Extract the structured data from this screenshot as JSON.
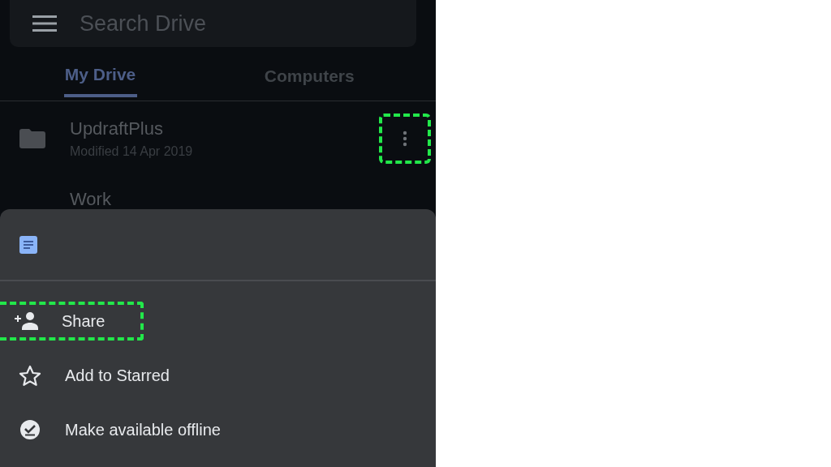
{
  "search": {
    "placeholder": "Search Drive"
  },
  "tabs": [
    {
      "label": "My Drive",
      "selected": true
    },
    {
      "label": "Computers",
      "selected": false
    }
  ],
  "files": [
    {
      "kind": "folder",
      "name": "UpdraftPlus",
      "subtitle": "Modified 14 Apr 2019",
      "more": {
        "highlighted": true
      }
    },
    {
      "name": "Work"
    }
  ],
  "sheet": {
    "actions": [
      {
        "kind": "share",
        "label": "Share",
        "highlighted": true
      },
      {
        "kind": "star",
        "label": "Add to Starred",
        "highlighted": false
      },
      {
        "kind": "offline",
        "label": "Make available offline",
        "highlighted": false
      }
    ]
  }
}
